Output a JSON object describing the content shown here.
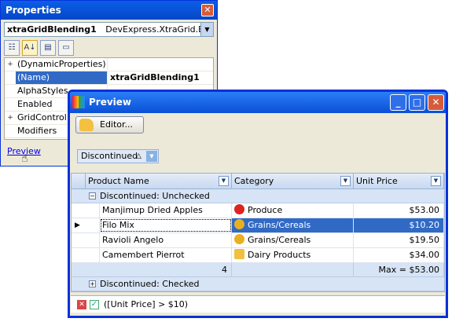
{
  "properties": {
    "title": "Properties",
    "object_name": "xtraGridBlending1",
    "object_type": "DevExpress.XtraGrid.Blend",
    "rows": [
      {
        "expander": "+",
        "name": "(DynamicProperties)",
        "value": ""
      },
      {
        "expander": "",
        "name": "(Name)",
        "value": "xtraGridBlending1"
      },
      {
        "expander": "",
        "name": "AlphaStyles",
        "value": ""
      },
      {
        "expander": "",
        "name": "Enabled",
        "value": ""
      },
      {
        "expander": "+",
        "name": "GridControl",
        "value": ""
      },
      {
        "expander": "",
        "name": "Modifiers",
        "value": ""
      }
    ],
    "link": "Preview"
  },
  "preview": {
    "title": "Preview",
    "editor_button": "Editor...",
    "group_chip": "Discontinued",
    "columns": [
      "Product Name",
      "Category",
      "Unit Price"
    ],
    "group_unchecked": "Discontinued: Unchecked",
    "group_checked": "Discontinued: Checked",
    "rows": [
      {
        "name": "Manjimup Dried Apples",
        "category": "Produce",
        "price": "$53.00"
      },
      {
        "name": "Filo Mix",
        "category": "Grains/Cereals",
        "price": "$10.20"
      },
      {
        "name": "Ravioli Angelo",
        "category": "Grains/Cereals",
        "price": "$19.50"
      },
      {
        "name": "Camembert Pierrot",
        "category": "Dairy Products",
        "price": "$34.00"
      }
    ],
    "footer_count": "4",
    "footer_max": "Max = $53.00",
    "filter": "([Unit Price] > $10)"
  }
}
